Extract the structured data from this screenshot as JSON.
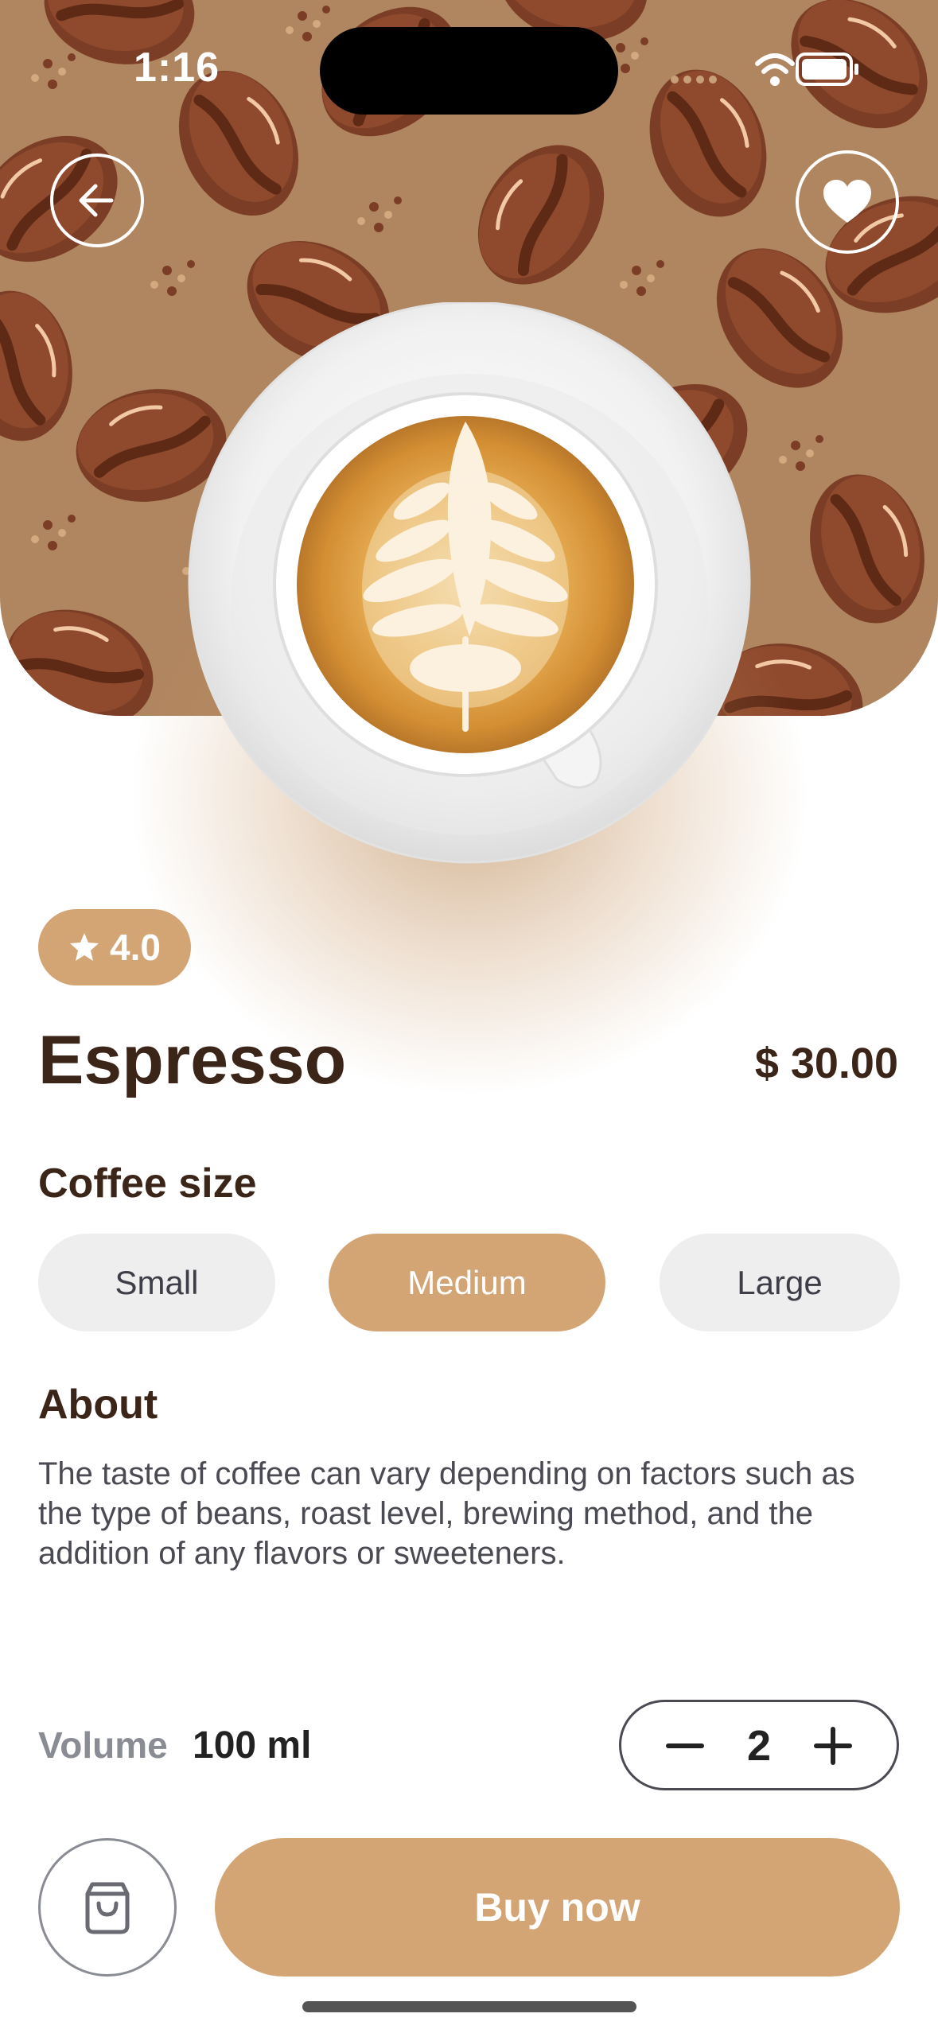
{
  "status_bar": {
    "time": "1:16",
    "wifi_icon": "wifi-icon",
    "battery_icon": "battery-icon"
  },
  "header": {
    "back_icon": "arrow-left-icon",
    "favorite_icon": "heart-icon"
  },
  "product": {
    "rating": "4.0",
    "rating_icon": "star-icon",
    "name": "Espresso",
    "price": "$ 30.00"
  },
  "size_section": {
    "heading": "Coffee size",
    "options": [
      {
        "label": "Small",
        "selected": false
      },
      {
        "label": "Medium",
        "selected": true
      },
      {
        "label": "Large",
        "selected": false
      }
    ]
  },
  "about": {
    "heading": "About",
    "text": "The taste of coffee can vary depending on factors such as the type of beans, roast level, brewing method, and the addition of any flavors or sweeteners."
  },
  "volume": {
    "label": "Volume",
    "value": "100 ml"
  },
  "quantity": {
    "value": "2"
  },
  "actions": {
    "cart_icon": "shopping-bag-icon",
    "buy_label": "Buy now"
  },
  "colors": {
    "accent": "#d3a575",
    "text_dark": "#3b2418",
    "chip_bg": "#eeeeee",
    "muted": "#8a8c94"
  }
}
